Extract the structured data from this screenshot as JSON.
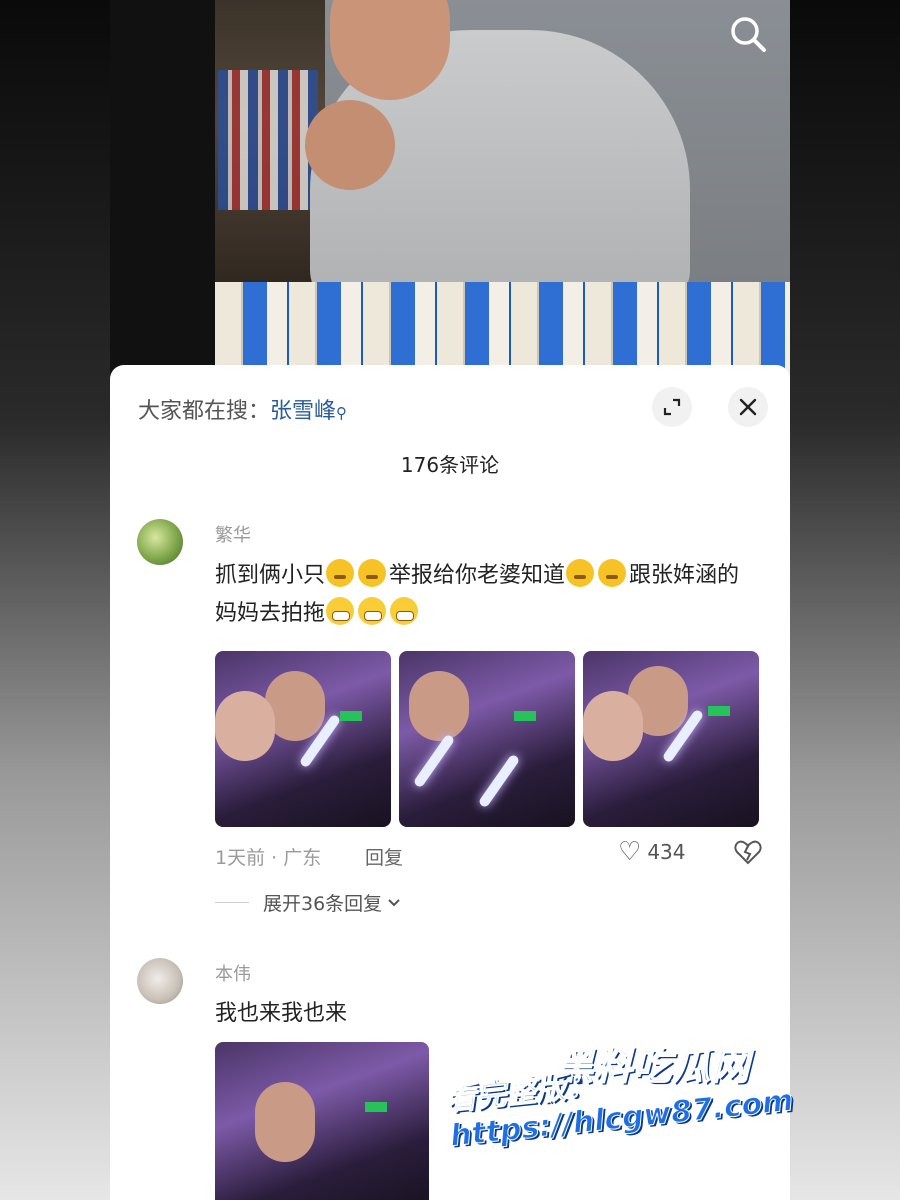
{
  "search_hint": {
    "prefix": "大家都在搜：",
    "keyword": "张雪峰",
    "icon": "search-icon"
  },
  "comment_count": "176条评论",
  "comments": [
    {
      "username": "繁华",
      "text_parts": [
        "抓到俩小只",
        "举报给你老婆知道",
        "跟张姩涵的妈妈去拍拖"
      ],
      "meta": "1天前 · 广东",
      "reply_label": "回复",
      "likes": "434",
      "expand_replies": "展开36条回复"
    },
    {
      "username": "本伟",
      "text": "我也来我也来"
    }
  ],
  "watermark": {
    "title": "黑料吃瓜网",
    "subtitle": "看完整版：https://hlcgw87.com"
  },
  "colors": {
    "keyword": "#2a5b9a",
    "panel_bg": "#ffffff",
    "watermark": "#2f7ff0"
  }
}
